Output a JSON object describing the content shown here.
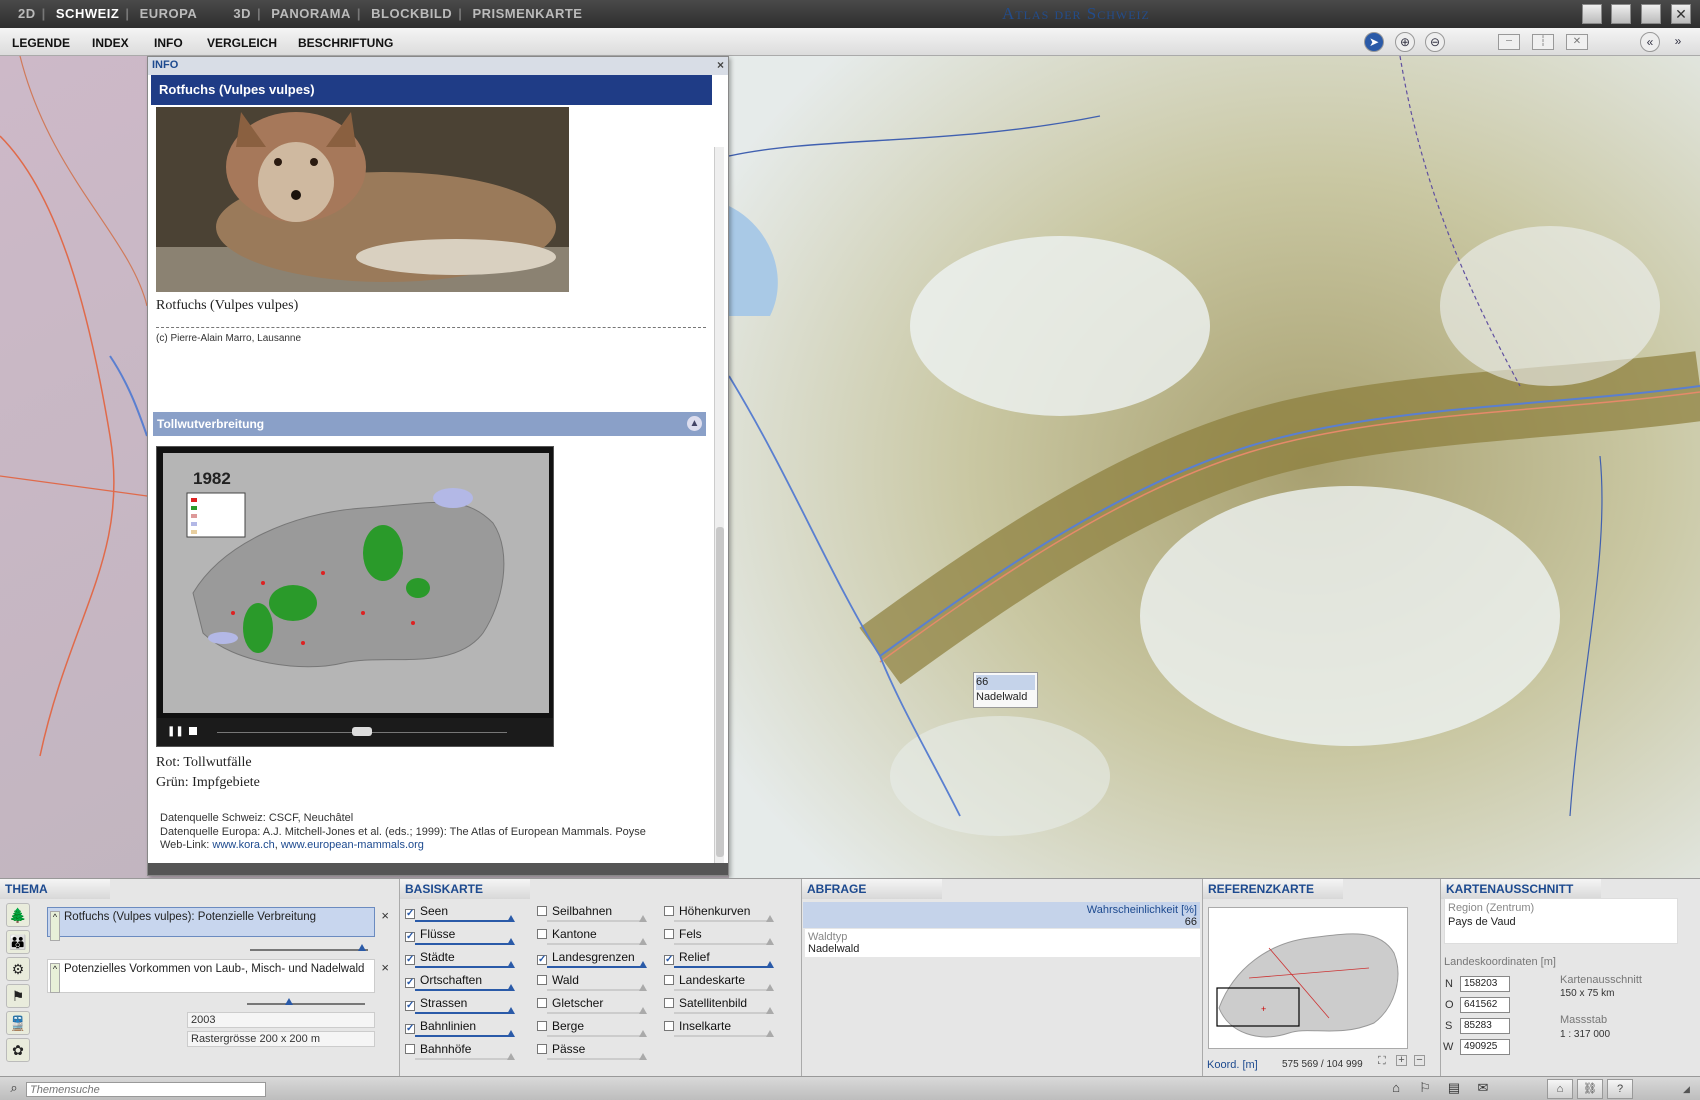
{
  "topnav": {
    "mode_2d": "2D",
    "schweiz": "SCHWEIZ",
    "europa": "EUROPA",
    "mode_3d": "3D",
    "panorama": "PANORAMA",
    "blockbild": "BLOCKBILD",
    "prismenkarte": "PRISMENKARTE",
    "app_title": "Atlas der Schweiz"
  },
  "menu": {
    "legende": "LEGENDE",
    "index": "INDEX",
    "info": "INFO",
    "vergleich": "VERGLEICH",
    "beschriftung": "BESCHRIFTUNG"
  },
  "info_panel": {
    "header": "INFO",
    "close": "×",
    "title": "Rotfuchs (Vulpes vulpes)",
    "photo_caption": "Rotfuchs (Vulpes vulpes)",
    "photo_credit": "(c) Pierre-Alain Marro, Lausanne",
    "section_title": "Tollwutverbreitung",
    "video_year": "1982",
    "note_red": "Rot: Tollwutfälle",
    "note_green": "Grün: Impfgebiete",
    "source_ch": "Datenquelle Schweiz: CSCF, Neuchâtel",
    "source_eu": "Datenquelle Europa: A.J. Mitchell-Jones et al. (eds.; 1999): The Atlas of European Mammals. Poyse",
    "weblink_label": "Web-Link: ",
    "weblink_1": "www.kora.ch",
    "weblink_sep": ", ",
    "weblink_2": "www.european-mammals.org"
  },
  "map_tooltip": {
    "value": "66",
    "label": "Nadelwald"
  },
  "thema": {
    "header": "THEMA",
    "item1": "Rotfuchs (Vulpes vulpes): Potenzielle Verbreitung",
    "item2": "Potenzielles Vorkommen von Laub-, Misch- und Nadelwald",
    "year": "2003",
    "raster": "Rastergrösse 200 x 200 m",
    "close": "×"
  },
  "basiskarte": {
    "header": "BASISKARTE",
    "col1": [
      {
        "label": "Seen",
        "checked": true
      },
      {
        "label": "Flüsse",
        "checked": true
      },
      {
        "label": "Städte",
        "checked": true
      },
      {
        "label": "Ortschaften",
        "checked": true
      },
      {
        "label": "Strassen",
        "checked": true
      },
      {
        "label": "Bahnlinien",
        "checked": true
      },
      {
        "label": "Bahnhöfe",
        "checked": false
      }
    ],
    "col2": [
      {
        "label": "Seilbahnen",
        "checked": false
      },
      {
        "label": "Kantone",
        "checked": false
      },
      {
        "label": "Landesgrenzen",
        "checked": true
      },
      {
        "label": "Wald",
        "checked": false
      },
      {
        "label": "Gletscher",
        "checked": false
      },
      {
        "label": "Berge",
        "checked": false
      },
      {
        "label": "Pässe",
        "checked": false
      }
    ],
    "col3": [
      {
        "label": "Höhenkurven",
        "checked": false
      },
      {
        "label": "Fels",
        "checked": false
      },
      {
        "label": "Relief",
        "checked": true
      },
      {
        "label": "Landeskarte",
        "checked": false
      },
      {
        "label": "Satellitenbild",
        "checked": false
      },
      {
        "label": "Inselkarte",
        "checked": false
      }
    ]
  },
  "abfrage": {
    "header": "ABFRAGE",
    "prob_label": "Wahrscheinlichkeit [%]",
    "prob_value": "66",
    "waldtyp_label": "Waldtyp",
    "waldtyp_value": "Nadelwald"
  },
  "referenzkarte": {
    "header": "REFERENZKARTE",
    "koord_label": "Koord. [m]",
    "koord_value": "575 569 / 104 999"
  },
  "kartenausschnitt": {
    "header": "KARTENAUSSCHNITT",
    "region_label": "Region (Zentrum)",
    "region_value": "Pays de Vaud",
    "landeskoord": "Landeskoordinaten [m]",
    "n_label": "N",
    "n_value": "158203",
    "o_label": "O",
    "o_value": "641562",
    "s_label": "S",
    "s_value": "85283",
    "w_label": "W",
    "w_value": "490925",
    "ausschnitt_label": "Kartenausschnitt",
    "ausschnitt_value": "150 x 75 km",
    "massstab_label": "Massstab",
    "massstab_value": "1 : 317 000"
  },
  "statusbar": {
    "search_placeholder": "Themensuche"
  }
}
